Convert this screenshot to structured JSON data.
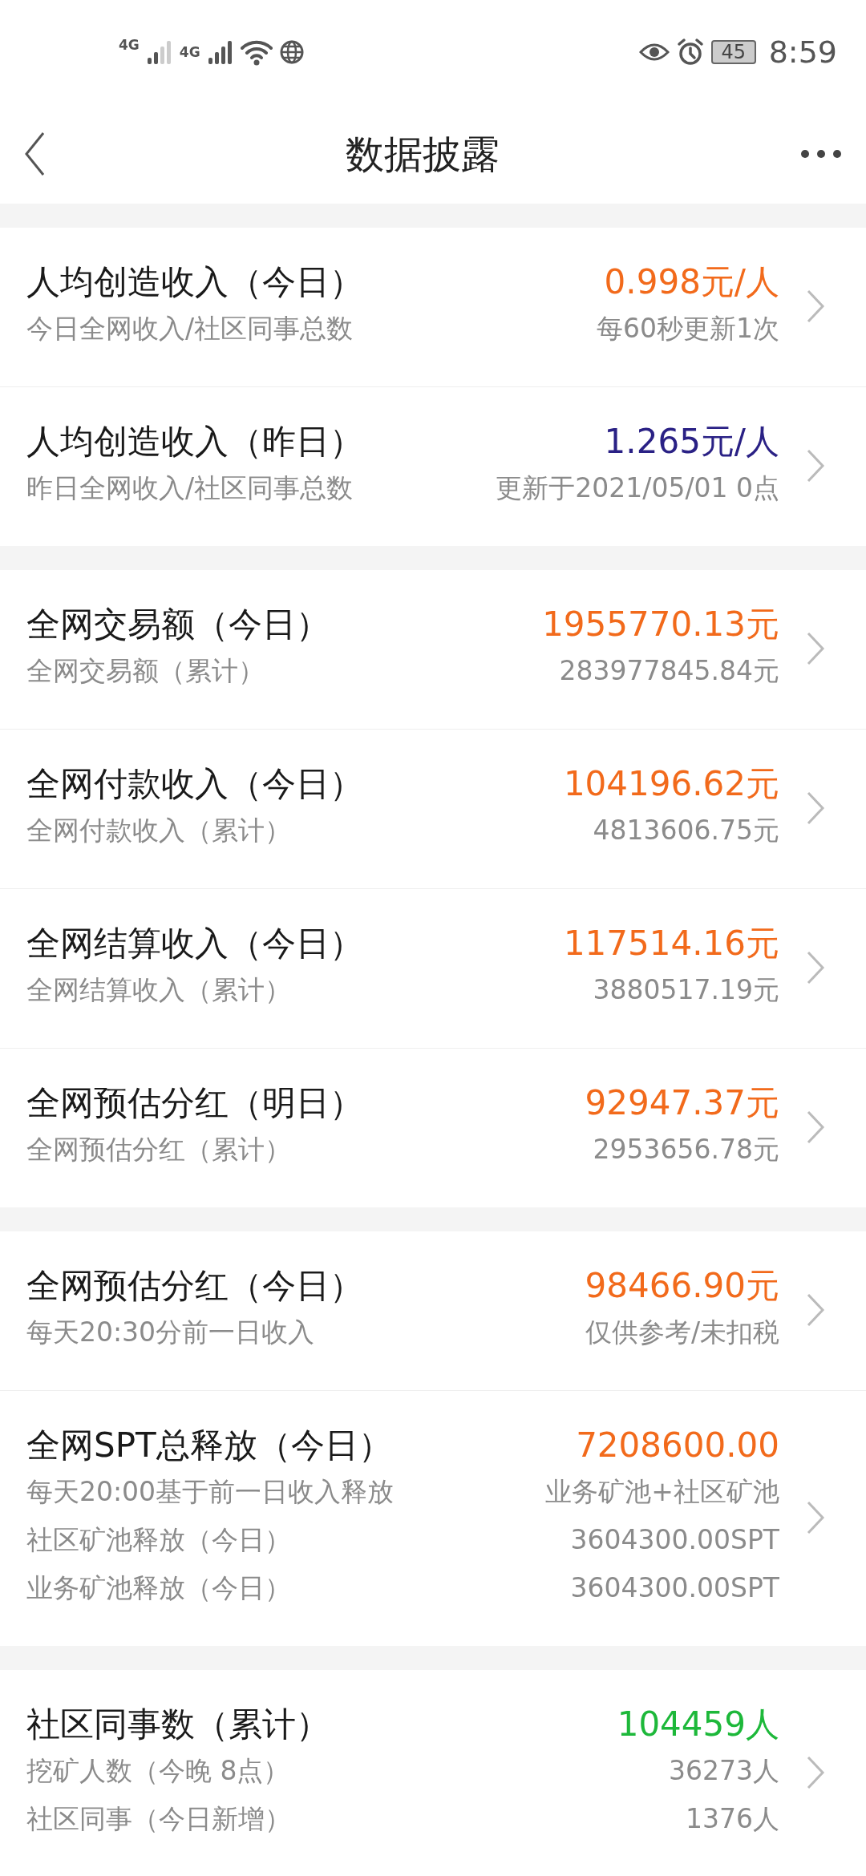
{
  "status_bar": {
    "time": "8:59",
    "battery": "45",
    "network_1": "4G",
    "network_2": "4G"
  },
  "header": {
    "title": "数据披露"
  },
  "groups": [
    {
      "rows": [
        {
          "title": "人均创造收入（今日）",
          "value": "0.998元/人",
          "color": "#f26a1b",
          "lines": [
            {
              "left": "今日全网收入/社区同事总数",
              "right": "每60秒更新1次"
            }
          ]
        },
        {
          "title": "人均创造收入（昨日）",
          "value": "1.265元/人",
          "color": "#2a2185",
          "lines": [
            {
              "left": "昨日全网收入/社区同事总数",
              "right": "更新于2021/05/01 0点"
            }
          ]
        }
      ]
    },
    {
      "rows": [
        {
          "title": "全网交易额（今日）",
          "value": "1955770.13元",
          "color": "#f26a1b",
          "lines": [
            {
              "left": "全网交易额（累计）",
              "right": "283977845.84元"
            }
          ]
        },
        {
          "title": "全网付款收入（今日）",
          "value": "104196.62元",
          "color": "#f26a1b",
          "lines": [
            {
              "left": "全网付款收入（累计）",
              "right": "4813606.75元"
            }
          ]
        },
        {
          "title": "全网结算收入（今日）",
          "value": "117514.16元",
          "color": "#f26a1b",
          "lines": [
            {
              "left": "全网结算收入（累计）",
              "right": "3880517.19元"
            }
          ]
        },
        {
          "title": "全网预估分红（明日）",
          "value": "92947.37元",
          "color": "#f26a1b",
          "lines": [
            {
              "left": "全网预估分红（累计）",
              "right": "2953656.78元"
            }
          ]
        }
      ]
    },
    {
      "rows": [
        {
          "title": "全网预估分红（今日）",
          "value": "98466.90元",
          "color": "#f26a1b",
          "lines": [
            {
              "left": "每天20:30分前一日收入",
              "right": "仅供参考/未扣税"
            }
          ]
        },
        {
          "title": "全网SPT总释放（今日）",
          "value": "7208600.00",
          "color": "#f26a1b",
          "lines": [
            {
              "left": "每天20:00基于前一日收入释放",
              "right": "业务矿池+社区矿池"
            },
            {
              "left": "社区矿池释放（今日）",
              "right": "3604300.00SPT"
            },
            {
              "left": "业务矿池释放（今日）",
              "right": "3604300.00SPT"
            }
          ]
        }
      ]
    },
    {
      "rows": [
        {
          "title": "社区同事数（累计）",
          "value": "104459人",
          "color": "#1db83a",
          "lines": [
            {
              "left": "挖矿人数（今晚 8点）",
              "right": "36273人"
            },
            {
              "left": "社区同事（今日新增）",
              "right": "1376人"
            }
          ]
        }
      ]
    }
  ]
}
